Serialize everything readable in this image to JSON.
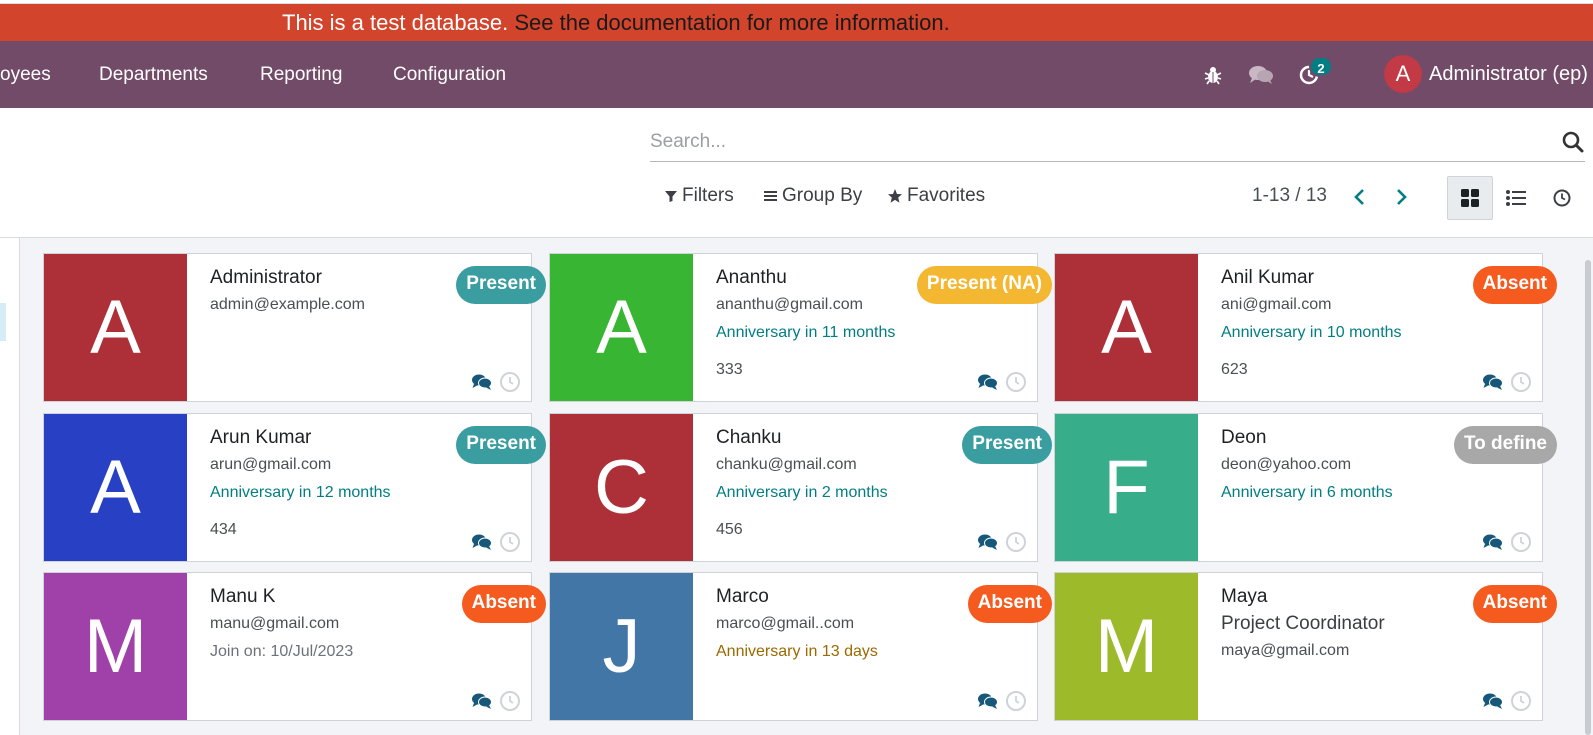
{
  "banner": {
    "text": "This is a test database.",
    "link": "See the documentation for more information."
  },
  "nav": {
    "items": [
      "oyees",
      "Departments",
      "Reporting",
      "Configuration"
    ],
    "badge": "2",
    "avatar_letter": "A",
    "user": "Administrator (ep)"
  },
  "control": {
    "search_placeholder": "Search...",
    "filters": "Filters",
    "group_by": "Group By",
    "favorites": "Favorites",
    "pager": "1-13 / 13"
  },
  "colors": {
    "navbar": "#714b67",
    "banner": "#d2442b",
    "present": "#3a9ea1",
    "present_na": "#f3b731",
    "absent": "#f55b1f",
    "to_define": "#a8a8a8",
    "teal_text": "#017e84"
  },
  "employees": [
    {
      "letter": "A",
      "color": "#ad3039",
      "name": "Administrator",
      "job": "",
      "email": "admin@example.com",
      "note": "",
      "code": "",
      "status": "Present",
      "status_kind": "present"
    },
    {
      "letter": "A",
      "color": "#37b533",
      "name": "Ananthu",
      "job": "",
      "email": "ananthu@gmail.com",
      "note": "Anniversary in 11 months",
      "code": "333",
      "status": "Present (NA)",
      "status_kind": "present_na"
    },
    {
      "letter": "A",
      "color": "#ad3039",
      "name": "Anil Kumar",
      "job": "",
      "email": "ani@gmail.com",
      "note": "Anniversary in 10 months",
      "code": "623",
      "status": "Absent",
      "status_kind": "absent"
    },
    {
      "letter": "A",
      "color": "#2740c4",
      "name": "Arun Kumar",
      "job": "",
      "email": "arun@gmail.com",
      "note": "Anniversary in 12 months",
      "code": "434",
      "status": "Present",
      "status_kind": "present"
    },
    {
      "letter": "C",
      "color": "#ad3039",
      "name": "Chanku",
      "job": "",
      "email": "chanku@gmail.com",
      "note": "Anniversary in 2 months",
      "code": "456",
      "status": "Present",
      "status_kind": "present"
    },
    {
      "letter": "F",
      "color": "#38ad89",
      "name": "Deon",
      "job": "",
      "email": "deon@yahoo.com",
      "note": "Anniversary in 6 months",
      "code": "",
      "status": "To define",
      "status_kind": "to_define"
    },
    {
      "letter": "M",
      "color": "#a041a9",
      "name": "Manu K",
      "job": "",
      "email": "manu@gmail.com",
      "note": "Join on: 10/Jul/2023",
      "code": "",
      "status": "Absent",
      "status_kind": "absent"
    },
    {
      "letter": "J",
      "color": "#4276a6",
      "name": "Marco",
      "job": "",
      "email": "marco@gmail..com",
      "note": "Anniversary in 13 days",
      "code": "",
      "status": "Absent",
      "status_kind": "absent"
    },
    {
      "letter": "M",
      "color": "#9dba2a",
      "name": "Maya",
      "job": "Project Coordinator",
      "email": "maya@gmail.com",
      "note": "",
      "code": "",
      "status": "Absent",
      "status_kind": "absent"
    }
  ]
}
